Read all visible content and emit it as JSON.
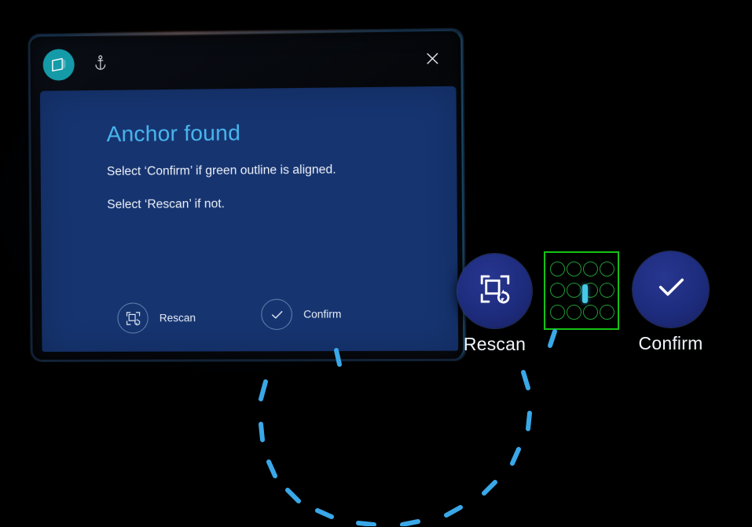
{
  "app": {
    "badge_icon": "mixed-reality-slate-icon",
    "anchor_icon": "anchor-icon",
    "close_icon": "close-icon"
  },
  "dialog": {
    "title": "Anchor found",
    "line1": "Select ‘Confirm’ if green outline is aligned.",
    "line2": "Select ‘Rescan’ if not.",
    "actions": [
      {
        "label": "Rescan",
        "icon": "rescan-frame-icon"
      },
      {
        "label": "Confirm",
        "icon": "checkmark-icon"
      }
    ]
  },
  "floating_buttons": [
    {
      "label": "Rescan",
      "icon": "rescan-frame-icon"
    },
    {
      "label": "Confirm",
      "icon": "checkmark-icon"
    }
  ],
  "anchor_outline": {
    "grid_rows": 3,
    "grid_cols": 4,
    "outline_color": "#16c216",
    "dot_color": "#1f9b35",
    "cursor_color": "#46c8e8"
  },
  "progress_arc": {
    "color": "#3aa8e8",
    "dash_count": 14
  },
  "colors": {
    "background": "#000000",
    "panel_surface": "#163470",
    "panel_bezel": "#0a0e16",
    "title_accent": "#49b6ee",
    "badge_teal": "#159aa8",
    "button_navy": "#1e2c7e",
    "text_primary": "#eef3fa"
  }
}
